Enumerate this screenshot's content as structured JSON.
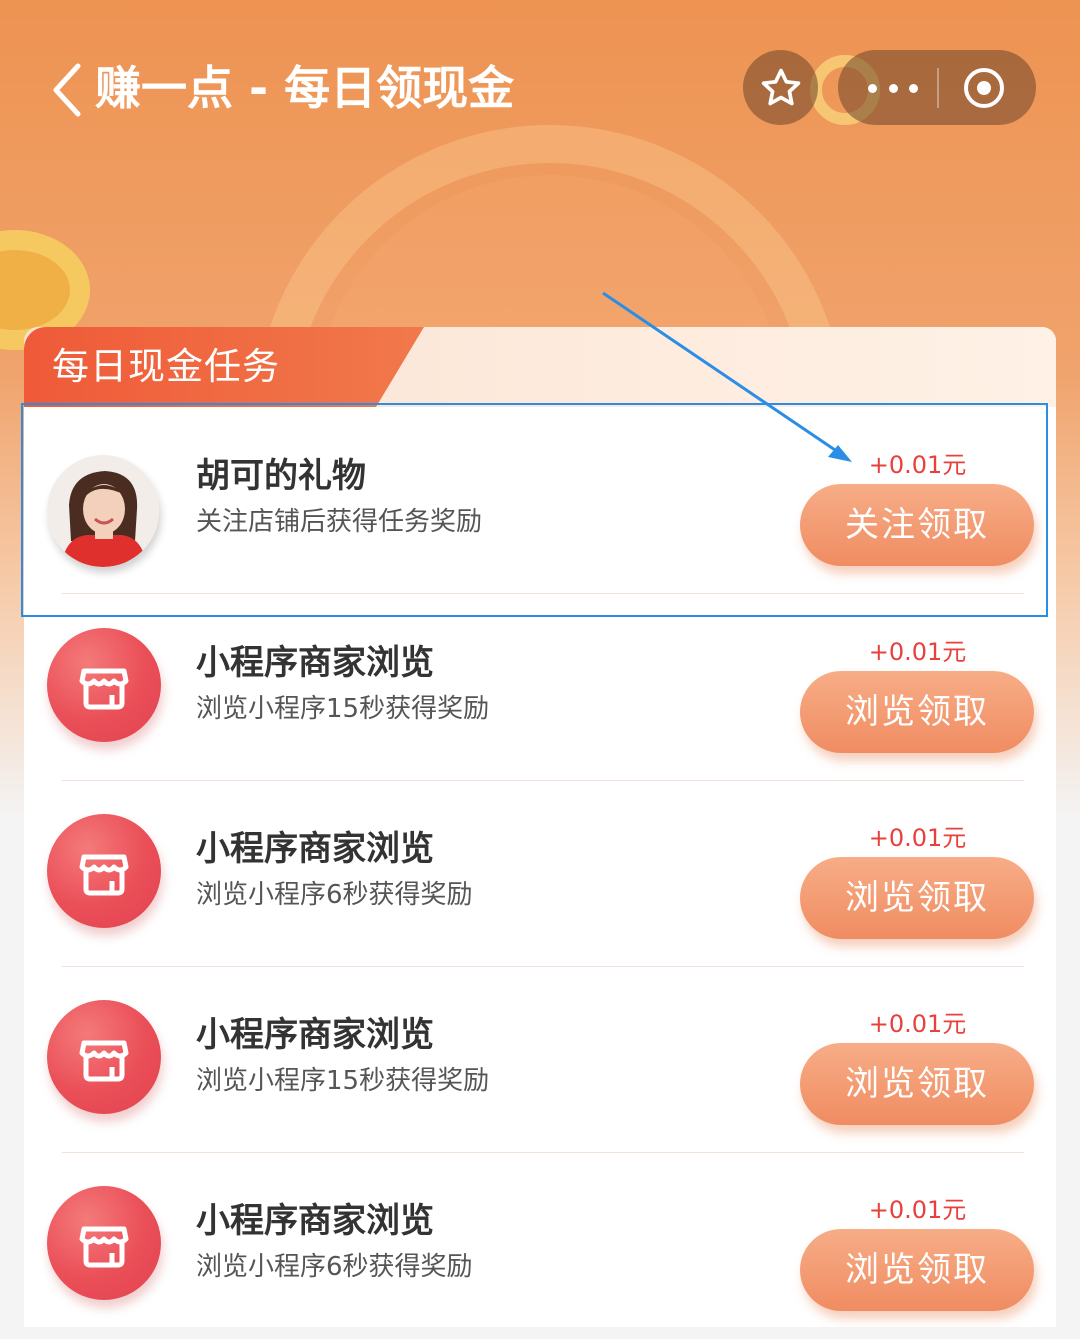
{
  "header": {
    "back_glyph": "‹",
    "title": "赚一点 - 每日领现金"
  },
  "section": {
    "title": "每日现金任务"
  },
  "tasks": [
    {
      "name": "胡可的礼物",
      "desc": "关注店铺后获得任务奖励",
      "reward": "+0.01元",
      "button": "关注领取",
      "icon": "avatar-photo"
    },
    {
      "name": "小程序商家浏览",
      "desc": "浏览小程序15秒获得奖励",
      "reward": "+0.01元",
      "button": "浏览领取",
      "icon": "store-icon"
    },
    {
      "name": "小程序商家浏览",
      "desc": "浏览小程序6秒获得奖励",
      "reward": "+0.01元",
      "button": "浏览领取",
      "icon": "store-icon"
    },
    {
      "name": "小程序商家浏览",
      "desc": "浏览小程序15秒获得奖励",
      "reward": "+0.01元",
      "button": "浏览领取",
      "icon": "store-icon"
    },
    {
      "name": "小程序商家浏览",
      "desc": "浏览小程序6秒获得奖励",
      "reward": "+0.01元",
      "button": "浏览领取",
      "icon": "store-icon"
    }
  ],
  "colors": {
    "accent": "#ef5a38",
    "reward": "#e8403c",
    "button": "#f08c62",
    "annotation": "#2a8ee6"
  }
}
